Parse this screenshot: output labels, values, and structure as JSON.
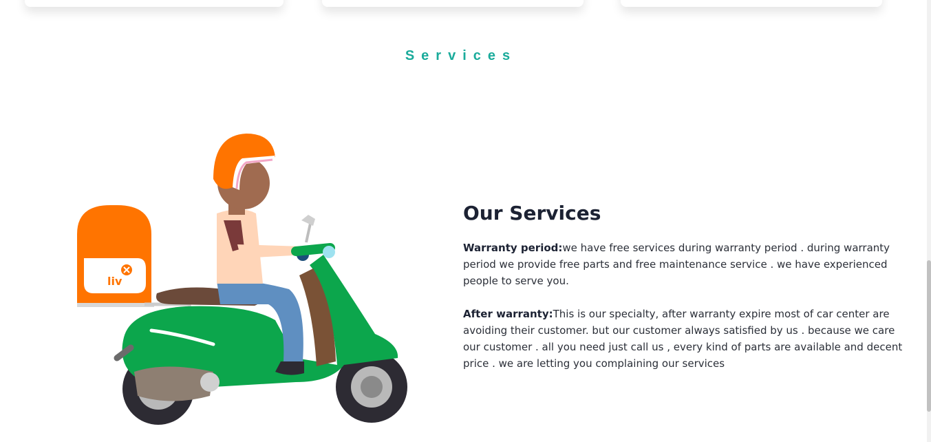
{
  "section": {
    "heading": "Services"
  },
  "services": {
    "title": "Our Services",
    "items": [
      {
        "label": "Warranty period:",
        "text": "we have free services during warranty period . during warranty period we provide free parts and free maintenance service . we have experienced people to serve you."
      },
      {
        "label": "After warranty:",
        "text": "This is our specialty, after warranty expire most of car center are avoiding their customer. but our customer always satisfied by us . because we care our customer . all you need just call us , every kind of parts are available and decent price . we are letting you complaining our services"
      }
    ]
  },
  "illustration": {
    "box_text": "liv",
    "icon": "scooter-delivery-rider-illustration"
  },
  "colors": {
    "accent": "#1aab9b",
    "heading": "#1c2233",
    "scooter_green": "#0ca64c",
    "helmet_orange": "#ff7400"
  }
}
